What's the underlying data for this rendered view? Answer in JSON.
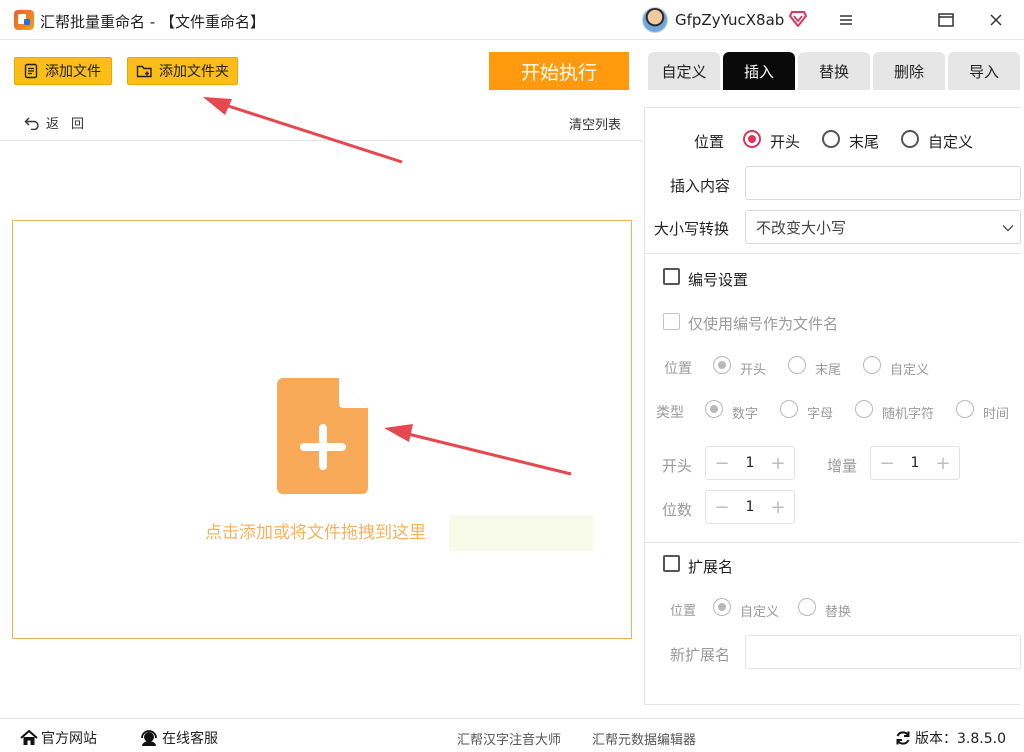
{
  "window": {
    "title": "汇帮批量重命名 - 【文件重命名】",
    "username": "GfpZyYucX8ab"
  },
  "toolbar": {
    "add_file": "添加文件",
    "add_folder": "添加文件夹",
    "start": "开始执行",
    "back": "返回",
    "clear_list": "清空列表"
  },
  "dropzone": {
    "text": "点击添加或将文件拖拽到这里"
  },
  "tabs": [
    {
      "label": "自定义",
      "active": false
    },
    {
      "label": "插入",
      "active": true
    },
    {
      "label": "替换",
      "active": false
    },
    {
      "label": "删除",
      "active": false
    },
    {
      "label": "导入",
      "active": false
    }
  ],
  "insert_panel": {
    "position_label": "位置",
    "position_options": [
      "开头",
      "末尾",
      "自定义"
    ],
    "position_selected": "开头",
    "content_label": "插入内容",
    "content_value": "",
    "case_label": "大小写转换",
    "case_value": "不改变大小写"
  },
  "numbering": {
    "title": "编号设置",
    "only_number": "仅使用编号作为文件名",
    "position_label": "位置",
    "position_options": [
      "开头",
      "末尾",
      "自定义"
    ],
    "position_selected": "开头",
    "type_label": "类型",
    "type_options": [
      "数字",
      "字母",
      "随机字符",
      "时间"
    ],
    "type_selected": "数字",
    "start_label": "开头",
    "start_value": "1",
    "increment_label": "增量",
    "increment_value": "1",
    "digits_label": "位数",
    "digits_value": "1"
  },
  "extension": {
    "title": "扩展名",
    "position_label": "位置",
    "options": [
      "自定义",
      "替换"
    ],
    "selected": "自定义",
    "new_ext_label": "新扩展名",
    "new_ext_value": ""
  },
  "footer": {
    "website": "官方网站",
    "support": "在线客服",
    "pinyin_tool": "汇帮汉字注音大师",
    "metadata_tool": "汇帮元数据编辑器",
    "version": "版本：3.8.5.0"
  },
  "colors": {
    "accent_yellow": "#fbbd17",
    "start_orange": "#ff9a0e",
    "radio_red": "#e0345a",
    "annotation_arrow": "#e8474f",
    "dropzone_orange": "#f6b35f"
  }
}
